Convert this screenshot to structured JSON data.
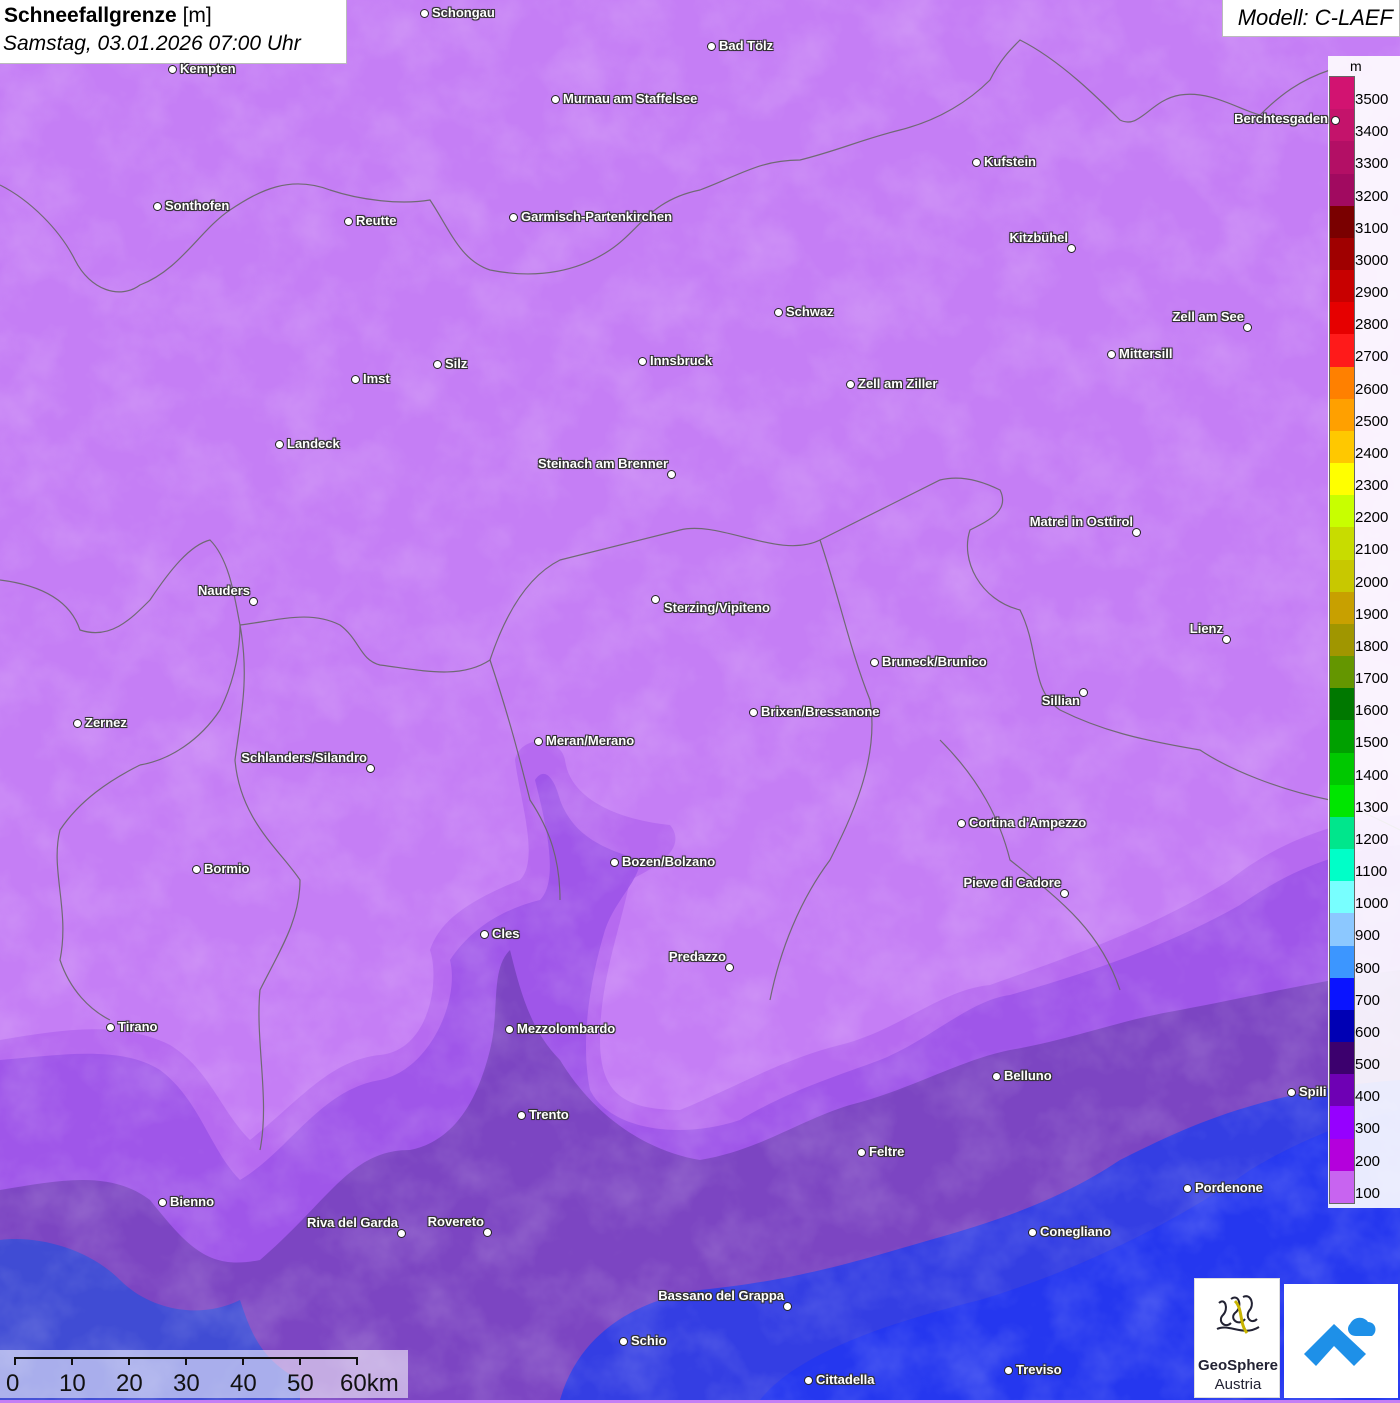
{
  "header": {
    "title_bold": "Schneefallgrenze",
    "title_unit": "[m]",
    "datetime": "Samstag, 03.01.2026 07:00 Uhr"
  },
  "model": {
    "label": "Modell: C-LAEF"
  },
  "legend": {
    "unit": "m",
    "levels": [
      {
        "label": "3500",
        "color": "#d21371"
      },
      {
        "label": "3400",
        "color": "#c4136b"
      },
      {
        "label": "3300",
        "color": "#b30f65"
      },
      {
        "label": "3200",
        "color": "#a10a60"
      },
      {
        "label": "3100",
        "color": "#7a0000"
      },
      {
        "label": "3000",
        "color": "#a00000"
      },
      {
        "label": "2900",
        "color": "#c80000"
      },
      {
        "label": "2800",
        "color": "#e60000"
      },
      {
        "label": "2700",
        "color": "#ff1a1a"
      },
      {
        "label": "2600",
        "color": "#ff8000"
      },
      {
        "label": "2500",
        "color": "#ffa000"
      },
      {
        "label": "2400",
        "color": "#ffc800"
      },
      {
        "label": "2300",
        "color": "#ffff00"
      },
      {
        "label": "2200",
        "color": "#c8ff00"
      },
      {
        "label": "2100",
        "color": "#c8dc00"
      },
      {
        "label": "2000",
        "color": "#c8c800"
      },
      {
        "label": "1900",
        "color": "#c8a000"
      },
      {
        "label": "1800",
        "color": "#a09600"
      },
      {
        "label": "1700",
        "color": "#649600"
      },
      {
        "label": "1600",
        "color": "#007800"
      },
      {
        "label": "1500",
        "color": "#00a000"
      },
      {
        "label": "1400",
        "color": "#00c800"
      },
      {
        "label": "1300",
        "color": "#00e600"
      },
      {
        "label": "1200",
        "color": "#00e68c"
      },
      {
        "label": "1100",
        "color": "#00ffc8"
      },
      {
        "label": "1000",
        "color": "#78ffff"
      },
      {
        "label": "900",
        "color": "#8cc8ff"
      },
      {
        "label": "800",
        "color": "#3c96ff"
      },
      {
        "label": "700",
        "color": "#0a14ff"
      },
      {
        "label": "600",
        "color": "#0000b4"
      },
      {
        "label": "500",
        "color": "#3c006e"
      },
      {
        "label": "400",
        "color": "#6e00b4"
      },
      {
        "label": "300",
        "color": "#9600ff"
      },
      {
        "label": "200",
        "color": "#b400dc"
      },
      {
        "label": "100",
        "color": "#c864f0"
      }
    ]
  },
  "cities": [
    {
      "name": "Schongau"
    },
    {
      "name": "Kempten"
    },
    {
      "name": "Bad Tölz"
    },
    {
      "name": "Murnau am Staffelsee"
    },
    {
      "name": "Berchtesgaden"
    },
    {
      "name": "Kufstein"
    },
    {
      "name": "Sonthofen"
    },
    {
      "name": "Reutte"
    },
    {
      "name": "Garmisch-Partenkirchen"
    },
    {
      "name": "Kitzbühel"
    },
    {
      "name": "Schwaz"
    },
    {
      "name": "Zell am See"
    },
    {
      "name": "Mittersill"
    },
    {
      "name": "Innsbruck"
    },
    {
      "name": "Imst"
    },
    {
      "name": "Silz"
    },
    {
      "name": "Zell am Ziller"
    },
    {
      "name": "Landeck"
    },
    {
      "name": "Steinach am Brenner"
    },
    {
      "name": "Matrei in Osttirol"
    },
    {
      "name": "Nauders"
    },
    {
      "name": "Sterzing/Vipiteno"
    },
    {
      "name": "Lienz"
    },
    {
      "name": "Bruneck/Brunico"
    },
    {
      "name": "Sillian"
    },
    {
      "name": "Zernez"
    },
    {
      "name": "Brixen/Bressanone"
    },
    {
      "name": "Meran/Merano"
    },
    {
      "name": "Schlanders/Silandro"
    },
    {
      "name": "Cortina d'Ampezzo"
    },
    {
      "name": "Bozen/Bolzano"
    },
    {
      "name": "Bormio"
    },
    {
      "name": "Pieve di Cadore"
    },
    {
      "name": "Cles"
    },
    {
      "name": "Predazzo"
    },
    {
      "name": "Tirano"
    },
    {
      "name": "Mezzolombardo"
    },
    {
      "name": "Belluno"
    },
    {
      "name": "Spili"
    },
    {
      "name": "Trento"
    },
    {
      "name": "Feltre"
    },
    {
      "name": "Pordenone"
    },
    {
      "name": "Bienno"
    },
    {
      "name": "Riva del Garda"
    },
    {
      "name": "Rovereto"
    },
    {
      "name": "Conegliano"
    },
    {
      "name": "Bassano del Grappa"
    },
    {
      "name": "Schio"
    },
    {
      "name": "Treviso"
    },
    {
      "name": "Cittadella"
    }
  ],
  "scalebar": {
    "ticks": [
      "0",
      "10",
      "20",
      "30",
      "40",
      "50",
      "60km"
    ]
  },
  "logos": {
    "geosphere_line1": "GeoSphere",
    "geosphere_line2": "Austria"
  }
}
